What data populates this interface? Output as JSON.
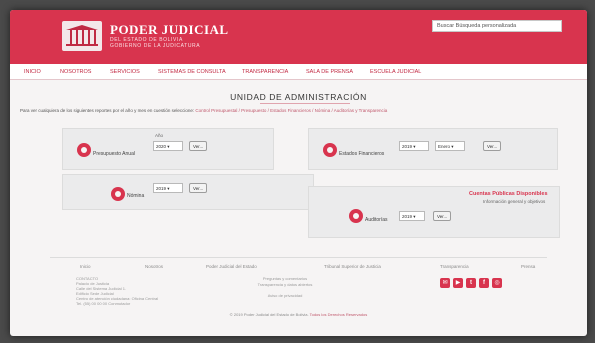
{
  "header": {
    "brand_title": "PODER JUDICIAL",
    "brand_sub1": "DEL ESTADO DE BOLIVIA",
    "brand_sub2": "GOBIERNO DE LA JUDICATURA",
    "search_value": "Buscar Búsqueda personalizada"
  },
  "nav": {
    "items": [
      "INICIO",
      "NOSOTROS",
      "SERVICIOS",
      "SISTEMAS DE CONSULTA",
      "TRANSPARENCIA",
      "SALA DE PRENSA",
      "ESCUELA JUDICIAL"
    ]
  },
  "main": {
    "title": "UNIDAD DE ADMINISTRACIÓN",
    "intro_text": "Para ver cualquiera de los siguientes reportes por el año y mes en cuestión seleccione:",
    "intro_links": "Control Presupuestal / Presupuesto / Estados Financieros / Nómina / Auditorías y Transparencia"
  },
  "cards": {
    "presupuesto": {
      "label": "Presupuesto Anual",
      "year_label": "Año",
      "year": "2020 ▾",
      "button": "Ver..."
    },
    "estados": {
      "label": "Estados Financieros",
      "year": "2019 ▾",
      "month": "Enero ▾",
      "button": "Ver..."
    },
    "nomina": {
      "label": "Nómina",
      "year": "2019 ▾",
      "button": "Ver..."
    },
    "auditorias": {
      "label": "Auditorías",
      "year": "2019 ▾",
      "button": "Ver...",
      "promo_title": "Cuentas Públicas Disponibles",
      "promo_sub": "Información general y objetivos"
    }
  },
  "footer": {
    "columns": [
      "Inicio",
      "Nosotros",
      "Poder Judicial del Estado",
      "Tribunal Superior de Justicia",
      "Transparencia",
      "Prensa"
    ],
    "contact": [
      "CONTACTO",
      "Palacio de Justicia",
      "Calle del Sistema Judicial 1.",
      "Edificio Sede Judicial",
      "Centro de atención ciudadana: Oficina Central",
      "Tel. (55) 00 00 00 Conmutador"
    ],
    "links": [
      "Preguntas y comentarios",
      "Transparencia y datos abiertos",
      "Aviso de privacidad"
    ],
    "social": [
      "✉",
      "▶",
      "t",
      "f",
      "◎"
    ],
    "copyright": "© 2019 Poder Judicial del Estado de Bolivia.",
    "copyright_hl": "Todos los Derechos Reservados"
  },
  "colors": {
    "brand": "#d8344e",
    "nav_text": "#c22a43"
  }
}
